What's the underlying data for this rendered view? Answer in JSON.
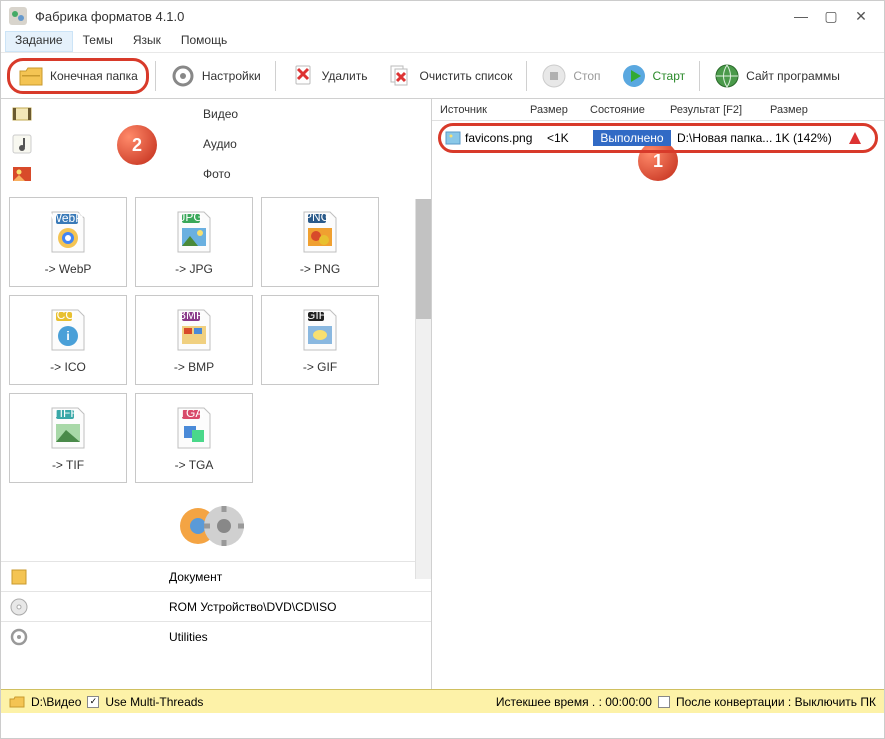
{
  "window": {
    "title": "Фабрика форматов 4.1.0"
  },
  "menu": {
    "task": "Задание",
    "themes": "Темы",
    "lang": "Язык",
    "help": "Помощь"
  },
  "toolbar": {
    "dstfolder": "Конечная папка",
    "settings": "Настройки",
    "delete": "Удалить",
    "clear": "Очистить список",
    "stop": "Стоп",
    "start": "Старт",
    "site": "Сайт программы"
  },
  "cats": {
    "video": "Видео",
    "audio": "Аудио",
    "photo": "Фото"
  },
  "formats": {
    "webp": "-> WebP",
    "jpg": "-> JPG",
    "png": "-> PNG",
    "ico": "-> ICO",
    "bmp": "-> BMP",
    "gif": "-> GIF",
    "tif": "-> TIF",
    "tga": "-> TGA"
  },
  "lists": {
    "doc": "Документ",
    "rom": "ROM Устройство\\DVD\\CD\\ISO",
    "util": "Utilities"
  },
  "table": {
    "h_src": "Источник",
    "h_size": "Размер",
    "h_state": "Состояние",
    "h_res": "Результат [F2]",
    "h_size2": "Размер",
    "row": {
      "name": "favicons.png",
      "size": "<1K",
      "state": "Выполнено",
      "result": "D:\\Новая папка...",
      "size2": "1K  (142%)"
    }
  },
  "status": {
    "path": "D:\\Видео",
    "multithr": "Use Multi-Threads",
    "elapsed": "Истекшее время . : 00:00:00",
    "afterconv": "После конвертации : Выключить ПК"
  },
  "badges": {
    "one": "1",
    "two": "2"
  }
}
